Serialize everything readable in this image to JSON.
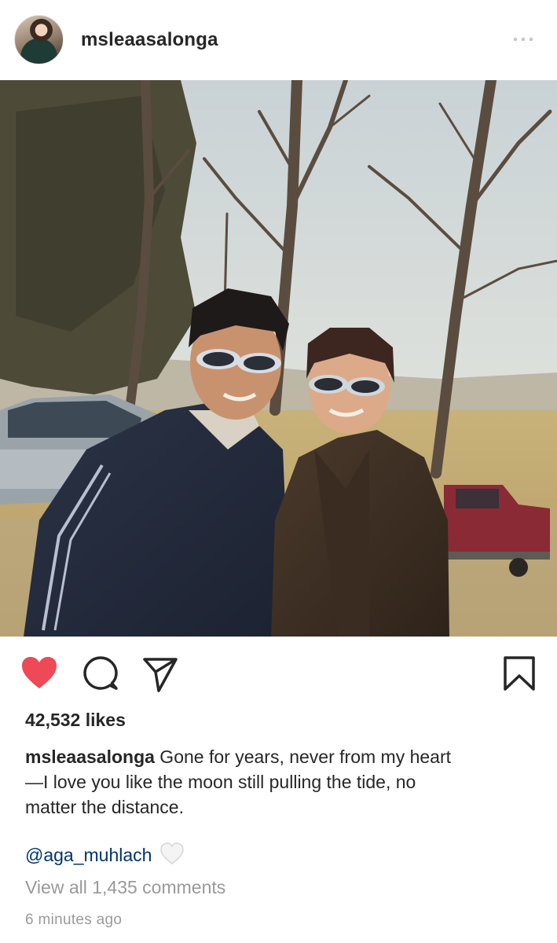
{
  "post": {
    "username": "msleaasalonga",
    "likes": "42,532 likes",
    "caption": {
      "username": "msleaasalonga",
      "line1": " Gone for years, never from my heart",
      "line2": "—I love you like the moon still pulling the tide, no",
      "line3": "matter the distance."
    },
    "mention": "@aga_muhlach",
    "view_comments": "View all 1,435 comments",
    "timestamp": "6 minutes ago"
  },
  "icons": {
    "more": "more-options-icon",
    "like": "heart-icon",
    "comment": "comment-icon",
    "share": "send-icon",
    "save": "bookmark-icon",
    "mention_emoji": "white-heart-icon"
  },
  "colors": {
    "like_red": "#ed4956",
    "text": "#262626",
    "muted": "#999999",
    "link": "#003569"
  }
}
